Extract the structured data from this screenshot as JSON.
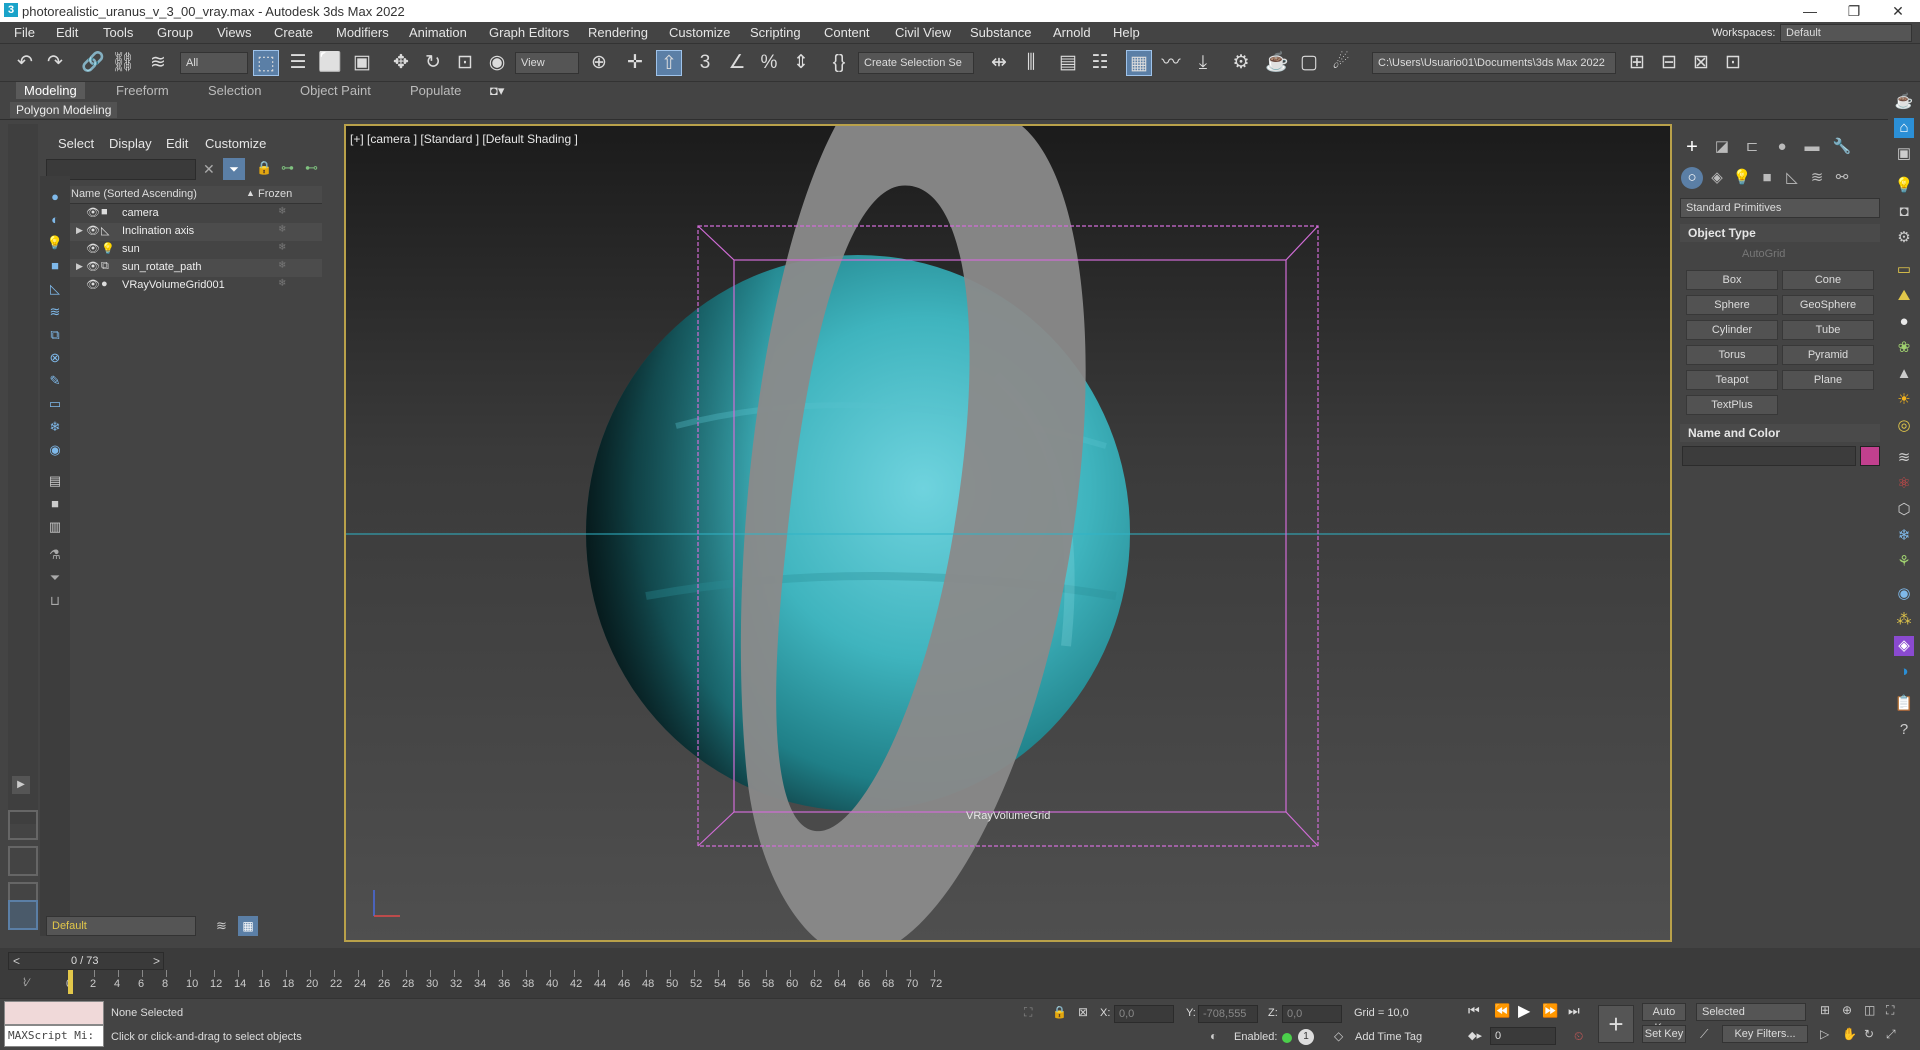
{
  "window": {
    "title": "photorealistic_uranus_v_3_00_vray.max - Autodesk 3ds Max 2022",
    "app_icon": "3"
  },
  "menu": [
    "File",
    "Edit",
    "Tools",
    "Group",
    "Views",
    "Create",
    "Modifiers",
    "Animation",
    "Graph Editors",
    "Rendering",
    "Customize",
    "Scripting",
    "Content",
    "Civil View",
    "Substance",
    "Arnold",
    "Help"
  ],
  "workspace": {
    "label": "Workspaces:",
    "value": "Default"
  },
  "toolbar": {
    "filter_value": "All",
    "refcoord_value": "View",
    "selection_set_placeholder": "Create Selection Se",
    "project_path": "C:\\Users\\Usuario01\\Documents\\3ds Max 2022"
  },
  "ribbon": {
    "tabs": [
      "Modeling",
      "Freeform",
      "Selection",
      "Object Paint",
      "Populate"
    ],
    "active_tab": "Modeling",
    "sub_label": "Polygon Modeling"
  },
  "scene_explorer": {
    "menu": [
      "Select",
      "Display",
      "Edit",
      "Customize"
    ],
    "col_name": "Name (Sorted Ascending)",
    "col_frozen": "Frozen",
    "sort_marker": "▲",
    "items": [
      {
        "name": "camera",
        "icon": "camera-icon",
        "expandable": false
      },
      {
        "name": "Inclination axis",
        "icon": "bone-icon",
        "expandable": true
      },
      {
        "name": "sun",
        "icon": "light-icon",
        "expandable": false
      },
      {
        "name": "sun_rotate_path",
        "icon": "group-icon",
        "expandable": true
      },
      {
        "name": "VRayVolumeGrid001",
        "icon": "volume-icon",
        "expandable": false
      }
    ],
    "layer_value": "Default"
  },
  "viewport": {
    "label": "[+] [camera ] [Standard ] [Default Shading ]",
    "gizmo_label": "VRayVolumeGrid"
  },
  "command_panel": {
    "dropdown": "Standard Primitives",
    "object_type_title": "Object Type",
    "autogrid_label": "AutoGrid",
    "buttons": [
      "Box",
      "Cone",
      "Sphere",
      "GeoSphere",
      "Cylinder",
      "Tube",
      "Torus",
      "Pyramid",
      "Teapot",
      "Plane",
      "TextPlus"
    ],
    "name_color_title": "Name and Color",
    "object_color": "#c2408e"
  },
  "timeline": {
    "frame_display": "0 / 73",
    "ticks": [
      "0",
      "2",
      "4",
      "6",
      "8",
      "10",
      "12",
      "14",
      "16",
      "18",
      "20",
      "22",
      "24",
      "26",
      "28",
      "30",
      "32",
      "34",
      "36",
      "38",
      "40",
      "42",
      "44",
      "46",
      "48",
      "50",
      "52",
      "54",
      "56",
      "58",
      "60",
      "62",
      "64",
      "66",
      "68",
      "70",
      "72"
    ]
  },
  "status": {
    "selection": "None Selected",
    "prompt": "Click or click-and-drag to select objects",
    "maxscript": "MAXScript Mi:",
    "x_label": "X:",
    "x_value": "0,0",
    "y_label": "Y:",
    "y_value": "-708,555",
    "z_label": "Z:",
    "z_value": "0,0",
    "grid": "Grid = 10,0",
    "enabled_label": "Enabled:",
    "add_time_tag": "Add Time Tag",
    "auto_key": "Auto Key",
    "set_key": "Set Key",
    "selected_value": "Selected",
    "key_filters": "Key Filters...",
    "frame_value": "0"
  }
}
